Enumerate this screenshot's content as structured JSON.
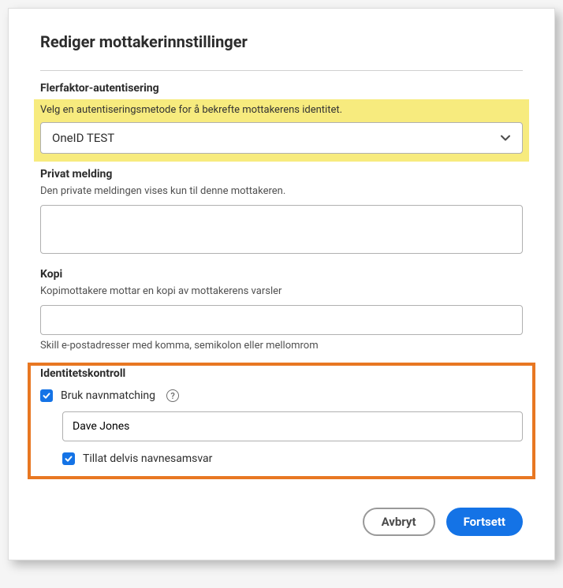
{
  "dialog": {
    "title": "Rediger mottakerinnstillinger"
  },
  "mfa": {
    "label": "Flerfaktor-autentisering",
    "desc": "Velg en autentiseringsmetode for å bekrefte mottakerens identitet.",
    "selected": "OneID TEST"
  },
  "privateMessage": {
    "label": "Privat melding",
    "desc": "Den private meldingen vises kun til denne mottakeren.",
    "value": ""
  },
  "copy": {
    "label": "Kopi",
    "desc": "Kopimottakere mottar en kopi av mottakerens varsler",
    "value": "",
    "helper": "Skill e-postadresser med komma, semikolon eller mellomrom"
  },
  "identity": {
    "label": "Identitetskontroll",
    "useNameMatching": {
      "label": "Bruk navnmatching",
      "checked": true
    },
    "nameValue": "Dave Jones",
    "allowPartial": {
      "label": "Tillat delvis navnesamsvar",
      "checked": true
    }
  },
  "buttons": {
    "cancel": "Avbryt",
    "continue": "Fortsett"
  },
  "colors": {
    "primary": "#1473e6",
    "highlight": "#f7eb7e",
    "callout": "#e87722"
  }
}
